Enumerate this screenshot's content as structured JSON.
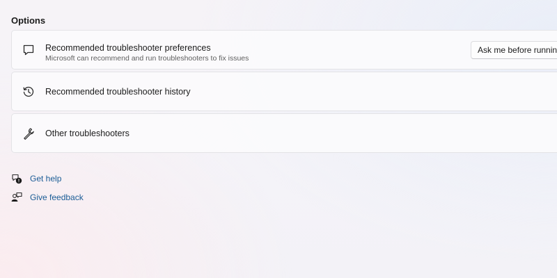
{
  "section": {
    "title": "Options"
  },
  "cards": [
    {
      "icon": "chat-bubble-icon",
      "title": "Recommended troubleshooter preferences",
      "subtitle": "Microsoft can recommend and run troubleshooters to fix issues",
      "dropdown_value": "Ask me before running"
    },
    {
      "icon": "history-icon",
      "title": "Recommended troubleshooter history"
    },
    {
      "icon": "wrench-icon",
      "title": "Other troubleshooters"
    }
  ],
  "links": [
    {
      "icon": "get-help-icon",
      "label": "Get help"
    },
    {
      "icon": "feedback-icon",
      "label": "Give feedback"
    }
  ],
  "colors": {
    "link": "#1a5c96",
    "text": "#1b1b1b",
    "subtext": "#5f5f5f"
  }
}
